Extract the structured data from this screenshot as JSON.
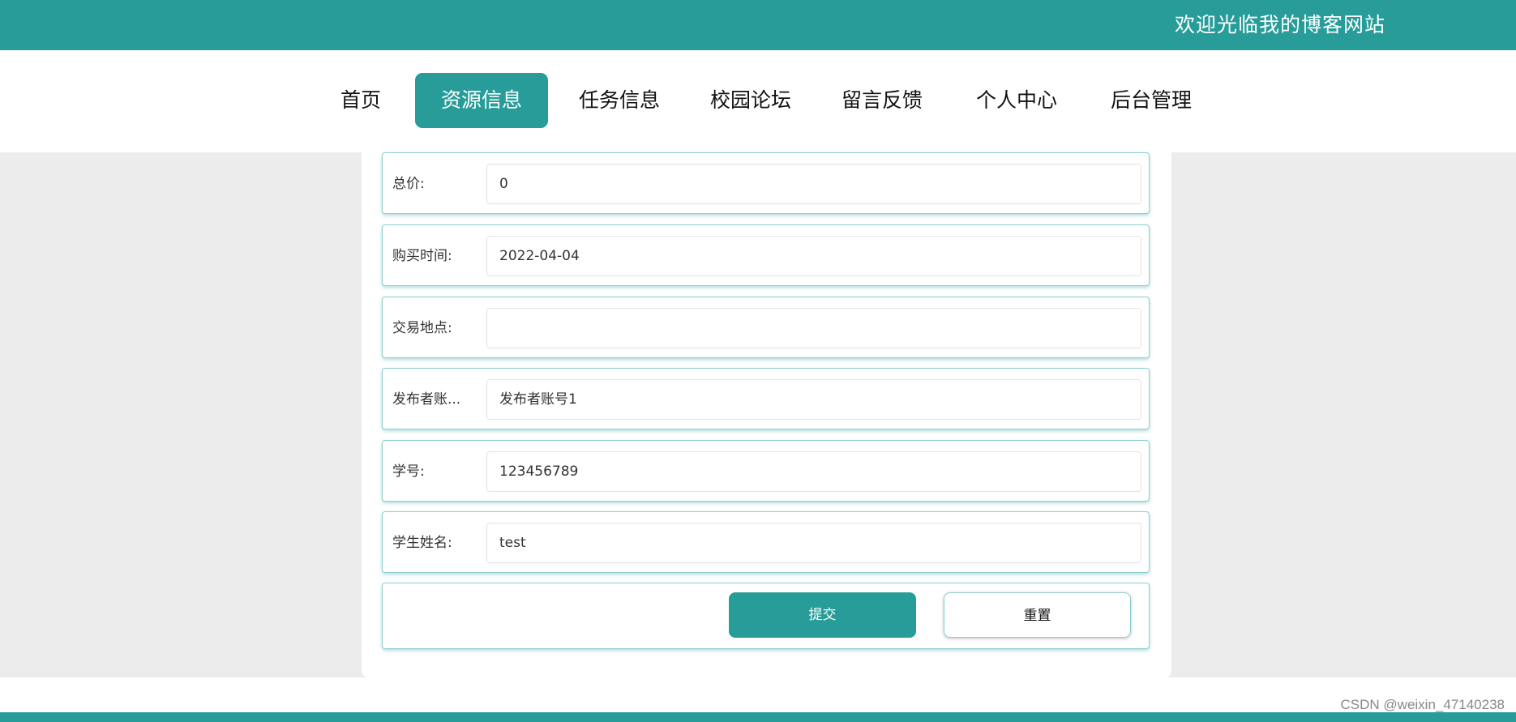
{
  "header": {
    "title": "欢迎光临我的博客网站"
  },
  "nav": {
    "items": [
      {
        "label": "首页"
      },
      {
        "label": "资源信息",
        "active": true
      },
      {
        "label": "任务信息"
      },
      {
        "label": "校园论坛"
      },
      {
        "label": "留言反馈"
      },
      {
        "label": "个人中心"
      },
      {
        "label": "后台管理"
      }
    ]
  },
  "form": {
    "fields": [
      {
        "label": "总价:",
        "value": "0"
      },
      {
        "label": "购买时间:",
        "value": "2022-04-04"
      },
      {
        "label": "交易地点:",
        "value": ""
      },
      {
        "label": "发布者账...",
        "value": "发布者账号1"
      },
      {
        "label": "学号:",
        "value": "123456789"
      },
      {
        "label": "学生姓名:",
        "value": "test"
      }
    ],
    "submit_label": "提交",
    "reset_label": "重置"
  },
  "watermark": "CSDN @weixin_47140238",
  "colors": {
    "accent": "#279c99",
    "background": "#ececec"
  }
}
